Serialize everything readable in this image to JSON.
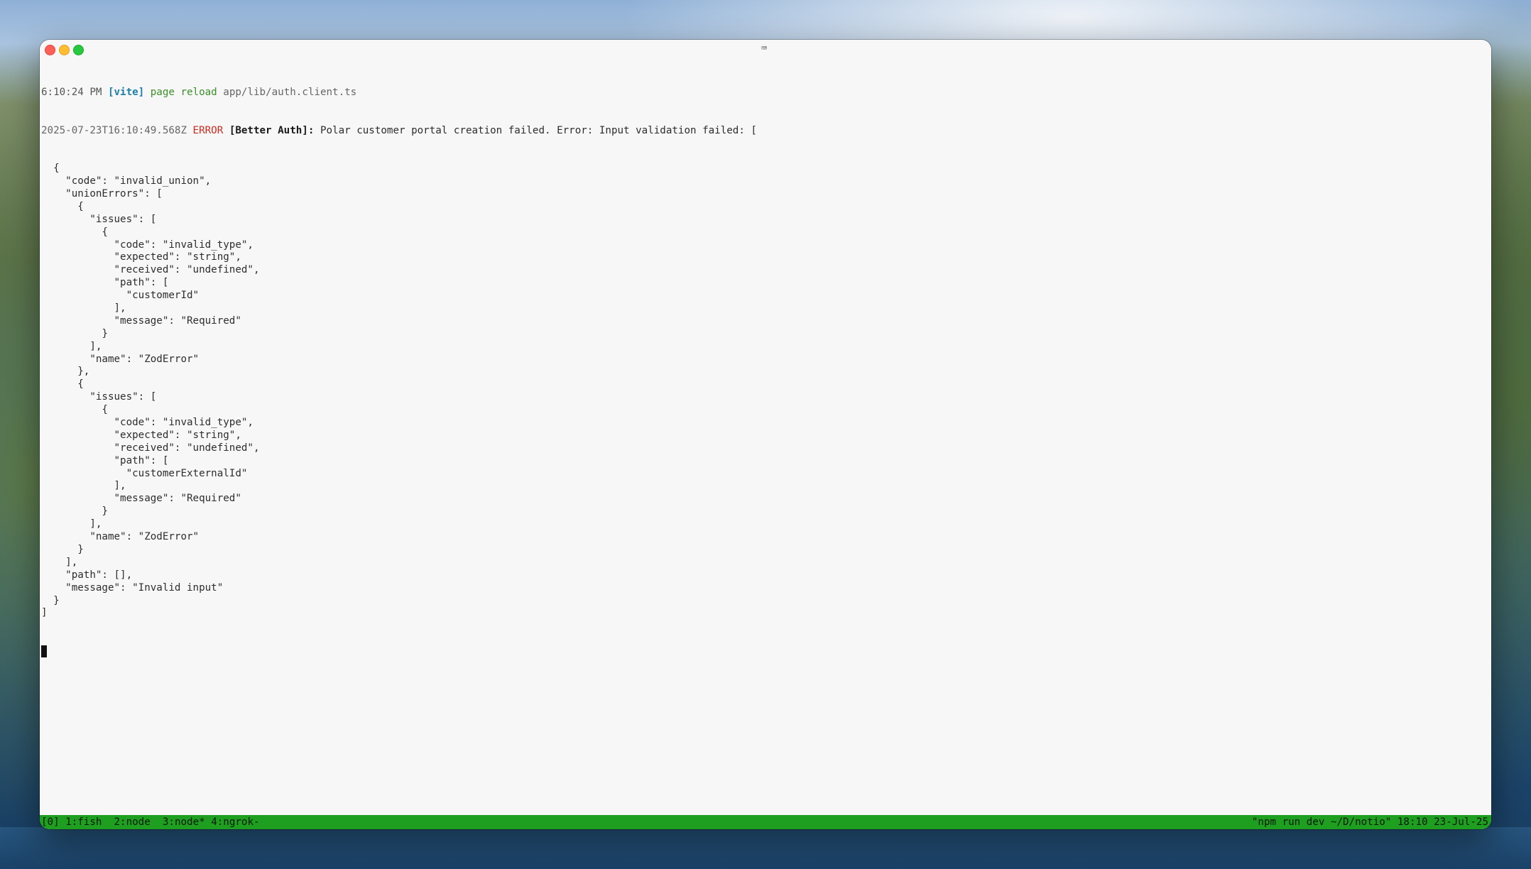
{
  "window": {
    "icon": "terminal-app-icon"
  },
  "terminal": {
    "line1": {
      "time": "6:10:24 PM",
      "tag": "[vite]",
      "action": "page reload",
      "file": "app/lib/auth.client.ts"
    },
    "line2": {
      "timestamp": "2025-07-23T16:10:49.568Z",
      "level": "ERROR",
      "source": "[Better Auth]:",
      "message": "Polar customer portal creation failed. Error: Input validation failed: ["
    },
    "body_lines": [
      "  {",
      "    \"code\": \"invalid_union\",",
      "    \"unionErrors\": [",
      "      {",
      "        \"issues\": [",
      "          {",
      "            \"code\": \"invalid_type\",",
      "            \"expected\": \"string\",",
      "            \"received\": \"undefined\",",
      "            \"path\": [",
      "              \"customerId\"",
      "            ],",
      "            \"message\": \"Required\"",
      "          }",
      "        ],",
      "        \"name\": \"ZodError\"",
      "      },",
      "      {",
      "        \"issues\": [",
      "          {",
      "            \"code\": \"invalid_type\",",
      "            \"expected\": \"string\",",
      "            \"received\": \"undefined\",",
      "            \"path\": [",
      "              \"customerExternalId\"",
      "            ],",
      "            \"message\": \"Required\"",
      "          }",
      "        ],",
      "        \"name\": \"ZodError\"",
      "      }",
      "    ],",
      "    \"path\": [],",
      "    \"message\": \"Invalid input\"",
      "  }",
      "]"
    ]
  },
  "statusbar": {
    "session": "[0]",
    "windows": [
      {
        "label": "1:fish"
      },
      {
        "label": "2:node"
      },
      {
        "label": "3:node*"
      },
      {
        "label": "4:ngrok-"
      }
    ],
    "right": "\"npm run dev ~/D/notio\" 18:10 23-Jul-25"
  },
  "colors": {
    "status_green": "#1f9f1f",
    "error_red": "#cc2b22",
    "vite_blue": "#1d7fa8"
  }
}
